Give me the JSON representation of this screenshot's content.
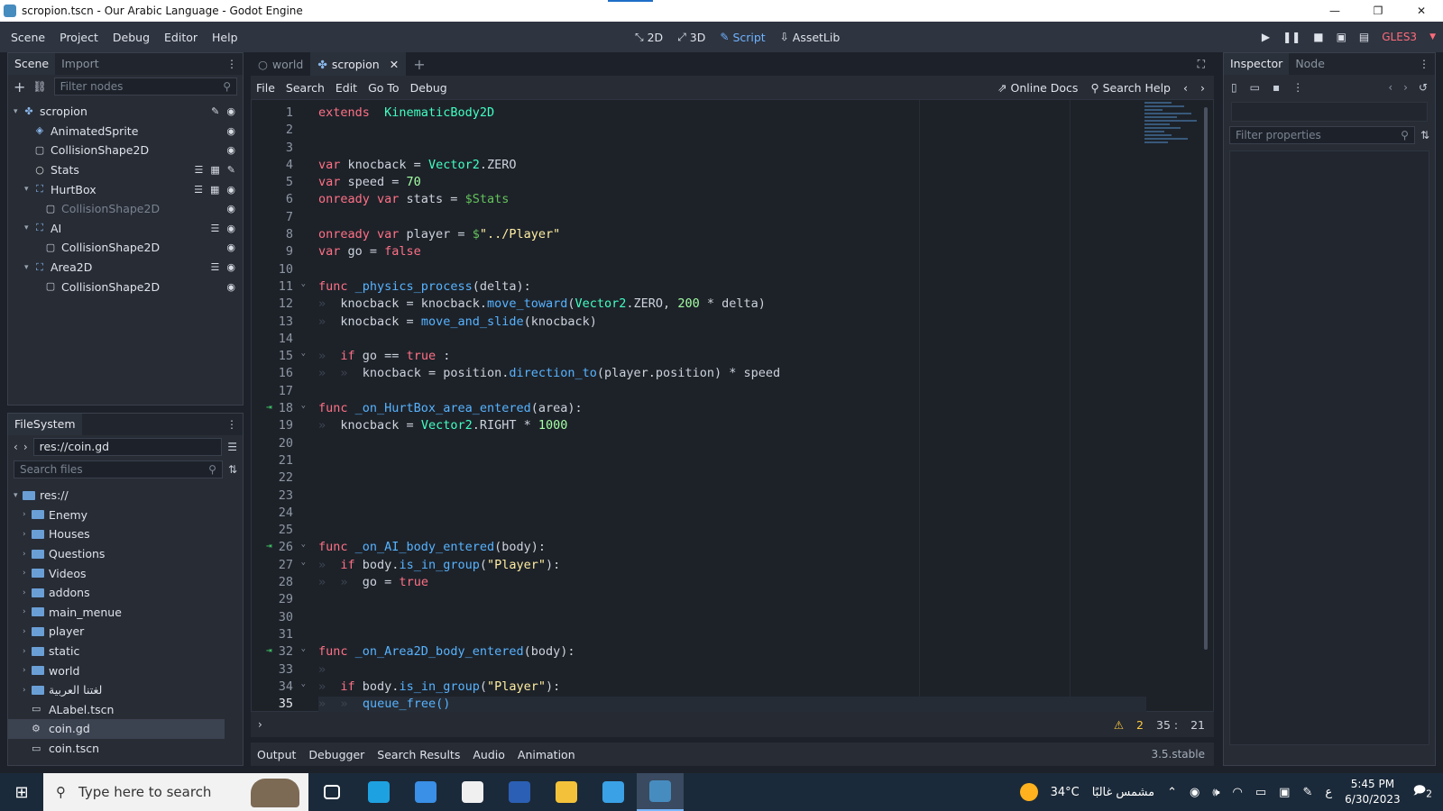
{
  "window": {
    "title": "scropion.tscn - Our Arabic Language - Godot Engine",
    "controls": [
      "—",
      "❐",
      "✕"
    ]
  },
  "menubar": {
    "items": [
      "Scene",
      "Project",
      "Debug",
      "Editor",
      "Help"
    ]
  },
  "workspaces": [
    {
      "label": "2D",
      "icon": "2d-icon"
    },
    {
      "label": "3D",
      "icon": "3d-icon"
    },
    {
      "label": "Script",
      "icon": "script-icon",
      "active": true
    },
    {
      "label": "AssetLib",
      "icon": "assetlib-icon"
    }
  ],
  "renderer": "GLES3",
  "scene_dock": {
    "tabs": [
      "Scene",
      "Import"
    ],
    "filter_placeholder": "Filter nodes",
    "nodes": [
      {
        "label": "scropion",
        "icon": "kinematic-body-icon",
        "depth": 0,
        "expanded": true,
        "icons": [
          "script-icon",
          "visibility-icon"
        ]
      },
      {
        "label": "AnimatedSprite",
        "icon": "animated-sprite-icon",
        "depth": 1,
        "icons": [
          "visibility-icon"
        ]
      },
      {
        "label": "CollisionShape2D",
        "icon": "collision-shape-icon",
        "depth": 1,
        "icons": [
          "visibility-icon"
        ]
      },
      {
        "label": "Stats",
        "icon": "node-icon",
        "depth": 1,
        "icons": [
          "signal-icon",
          "scene-instance-icon",
          "script-icon"
        ]
      },
      {
        "label": "HurtBox",
        "icon": "area-icon",
        "depth": 1,
        "expanded": true,
        "icons": [
          "signal-icon",
          "scene-instance-icon",
          "visibility-icon"
        ]
      },
      {
        "label": "CollisionShape2D",
        "icon": "collision-shape-icon",
        "depth": 2,
        "dim": true,
        "icons": [
          "visibility-icon"
        ]
      },
      {
        "label": "AI",
        "icon": "area-icon",
        "depth": 1,
        "expanded": true,
        "icons": [
          "signal-icon",
          "visibility-icon"
        ]
      },
      {
        "label": "CollisionShape2D",
        "icon": "collision-shape-icon",
        "depth": 2,
        "icons": [
          "visibility-icon"
        ]
      },
      {
        "label": "Area2D",
        "icon": "area-icon",
        "depth": 1,
        "expanded": true,
        "icons": [
          "signal-icon",
          "visibility-icon"
        ]
      },
      {
        "label": "CollisionShape2D",
        "icon": "collision-shape-icon",
        "depth": 2,
        "icons": [
          "visibility-icon"
        ]
      }
    ]
  },
  "filesystem": {
    "tab": "FileSystem",
    "path": "res://coin.gd",
    "search_placeholder": "Search files",
    "items": [
      {
        "label": "res://",
        "kind": "root"
      },
      {
        "label": "Enemy",
        "kind": "folder"
      },
      {
        "label": "Houses",
        "kind": "folder"
      },
      {
        "label": "Questions",
        "kind": "folder"
      },
      {
        "label": "Videos",
        "kind": "folder"
      },
      {
        "label": "addons",
        "kind": "folder"
      },
      {
        "label": "main_menue",
        "kind": "folder"
      },
      {
        "label": "player",
        "kind": "folder"
      },
      {
        "label": "static",
        "kind": "folder"
      },
      {
        "label": "world",
        "kind": "folder"
      },
      {
        "label": "لغتنا العربية",
        "kind": "folder"
      },
      {
        "label": "ALabel.tscn",
        "kind": "scene"
      },
      {
        "label": "coin.gd",
        "kind": "script",
        "selected": true
      },
      {
        "label": "coin.tscn",
        "kind": "scene"
      }
    ]
  },
  "scene_tabs": [
    {
      "label": "world",
      "icon": "node-icon"
    },
    {
      "label": "scropion",
      "icon": "kinematic-body-icon",
      "active": true
    }
  ],
  "script_menu": [
    "File",
    "Search",
    "Edit",
    "Go To",
    "Debug"
  ],
  "script_right": {
    "docs": "Online Docs",
    "help": "Search Help"
  },
  "code": [
    [
      [
        "kw",
        "extends"
      ],
      [
        "",
        "  "
      ],
      [
        "ty",
        "KinematicBody2D"
      ]
    ],
    [],
    [],
    [
      [
        "kw",
        "var"
      ],
      [
        "",
        " knocback = "
      ],
      [
        "ty",
        "Vector2"
      ],
      [
        "",
        ".ZERO"
      ]
    ],
    [
      [
        "kw",
        "var"
      ],
      [
        "",
        " speed = "
      ],
      [
        "nm",
        "70"
      ]
    ],
    [
      [
        "kw",
        "onready var"
      ],
      [
        "",
        " stats = "
      ],
      [
        "nd",
        "$Stats"
      ]
    ],
    [],
    [
      [
        "kw",
        "onready var"
      ],
      [
        "",
        " player = "
      ],
      [
        "nd",
        "$"
      ],
      [
        "st",
        "\"../Player\""
      ]
    ],
    [
      [
        "kw",
        "var"
      ],
      [
        "",
        " go = "
      ],
      [
        "kw",
        "false"
      ]
    ],
    [],
    [
      [
        "kw",
        "func"
      ],
      [
        "",
        " "
      ],
      [
        "fn",
        "_physics_process"
      ],
      [
        "",
        "(delta):"
      ]
    ],
    [
      [
        "tab",
        "»"
      ],
      [
        "",
        "  knocback = knocback."
      ],
      [
        "fn",
        "move_toward"
      ],
      [
        "",
        "("
      ],
      [
        "ty",
        "Vector2"
      ],
      [
        "",
        ".ZERO, "
      ],
      [
        "nm",
        "200"
      ],
      [
        "",
        " * delta)"
      ]
    ],
    [
      [
        "tab",
        "»"
      ],
      [
        "",
        "  knocback = "
      ],
      [
        "fn",
        "move_and_slide"
      ],
      [
        "",
        "(knocback)"
      ]
    ],
    [],
    [
      [
        "tab",
        "»"
      ],
      [
        "",
        "  "
      ],
      [
        "kw",
        "if"
      ],
      [
        "",
        " go == "
      ],
      [
        "kw",
        "true"
      ],
      [
        "",
        " :"
      ]
    ],
    [
      [
        "tab",
        "»"
      ],
      [
        "",
        "  "
      ],
      [
        "tab",
        "»"
      ],
      [
        "",
        "  knocback = position."
      ],
      [
        "fn",
        "direction_to"
      ],
      [
        "",
        "(player.position) * speed"
      ]
    ],
    [],
    [
      [
        "kw",
        "func"
      ],
      [
        "",
        " "
      ],
      [
        "fn",
        "_on_HurtBox_area_entered"
      ],
      [
        "",
        "(area):"
      ]
    ],
    [
      [
        "tab",
        "»"
      ],
      [
        "",
        "  knocback = "
      ],
      [
        "ty",
        "Vector2"
      ],
      [
        "",
        ".RIGHT * "
      ],
      [
        "nm",
        "1000"
      ]
    ],
    [],
    [],
    [],
    [],
    [],
    [],
    [
      [
        "kw",
        "func"
      ],
      [
        "",
        " "
      ],
      [
        "fn",
        "_on_AI_body_entered"
      ],
      [
        "",
        "(body):"
      ]
    ],
    [
      [
        "tab",
        "»"
      ],
      [
        "",
        "  "
      ],
      [
        "kw",
        "if"
      ],
      [
        "",
        " body."
      ],
      [
        "fn",
        "is_in_group"
      ],
      [
        "",
        "("
      ],
      [
        "st",
        "\"Player\""
      ],
      [
        "",
        "):"
      ]
    ],
    [
      [
        "tab",
        "»"
      ],
      [
        "",
        "  "
      ],
      [
        "tab",
        "»"
      ],
      [
        "",
        "  go = "
      ],
      [
        "kw",
        "true"
      ]
    ],
    [],
    [],
    [],
    [
      [
        "kw",
        "func"
      ],
      [
        "",
        " "
      ],
      [
        "fn",
        "_on_Area2D_body_entered"
      ],
      [
        "",
        "(body):"
      ]
    ],
    [
      [
        "tab",
        "»"
      ]
    ],
    [
      [
        "tab",
        "»"
      ],
      [
        "",
        "  "
      ],
      [
        "kw",
        "if"
      ],
      [
        "",
        " body."
      ],
      [
        "fn",
        "is_in_group"
      ],
      [
        "",
        "("
      ],
      [
        "st",
        "\"Player\""
      ],
      [
        "",
        "):"
      ]
    ],
    [
      [
        "tab",
        "»"
      ],
      [
        "",
        "  "
      ],
      [
        "tab",
        "»"
      ],
      [
        "",
        "  "
      ],
      [
        "fn",
        "queue_free()"
      ]
    ]
  ],
  "gutter": {
    "signal_lines": [
      18,
      26,
      32
    ],
    "fold_lines": [
      11,
      15,
      18,
      26,
      27,
      32,
      34
    ],
    "current_line": 35
  },
  "status": {
    "warnings": "2",
    "line": "35",
    "sep": ":",
    "col": "21"
  },
  "bottom_tabs": [
    "Output",
    "Debugger",
    "Search Results",
    "Audio",
    "Animation"
  ],
  "version": "3.5.stable",
  "inspector": {
    "tabs": [
      "Inspector",
      "Node"
    ],
    "filter_placeholder": "Filter properties"
  },
  "taskbar": {
    "search_placeholder": "Type here to search",
    "apps": [
      {
        "name": "task-view",
        "color": "#ffffff"
      },
      {
        "name": "edge",
        "color": "#1ea1e0"
      },
      {
        "name": "mail",
        "color": "#3a8fe6"
      },
      {
        "name": "store",
        "color": "#f0f0f0"
      },
      {
        "name": "word",
        "color": "#2b5fb5"
      },
      {
        "name": "file-explorer",
        "color": "#f3c23a"
      },
      {
        "name": "photos",
        "color": "#3aa1e6"
      },
      {
        "name": "godot",
        "color": "#478cbf",
        "active": true
      }
    ],
    "weather": {
      "temp": "34°C",
      "desc": "مشمس غالبًا"
    },
    "lang": "ع",
    "time": "5:45 PM",
    "date": "6/30/2023",
    "notifications": "2"
  }
}
